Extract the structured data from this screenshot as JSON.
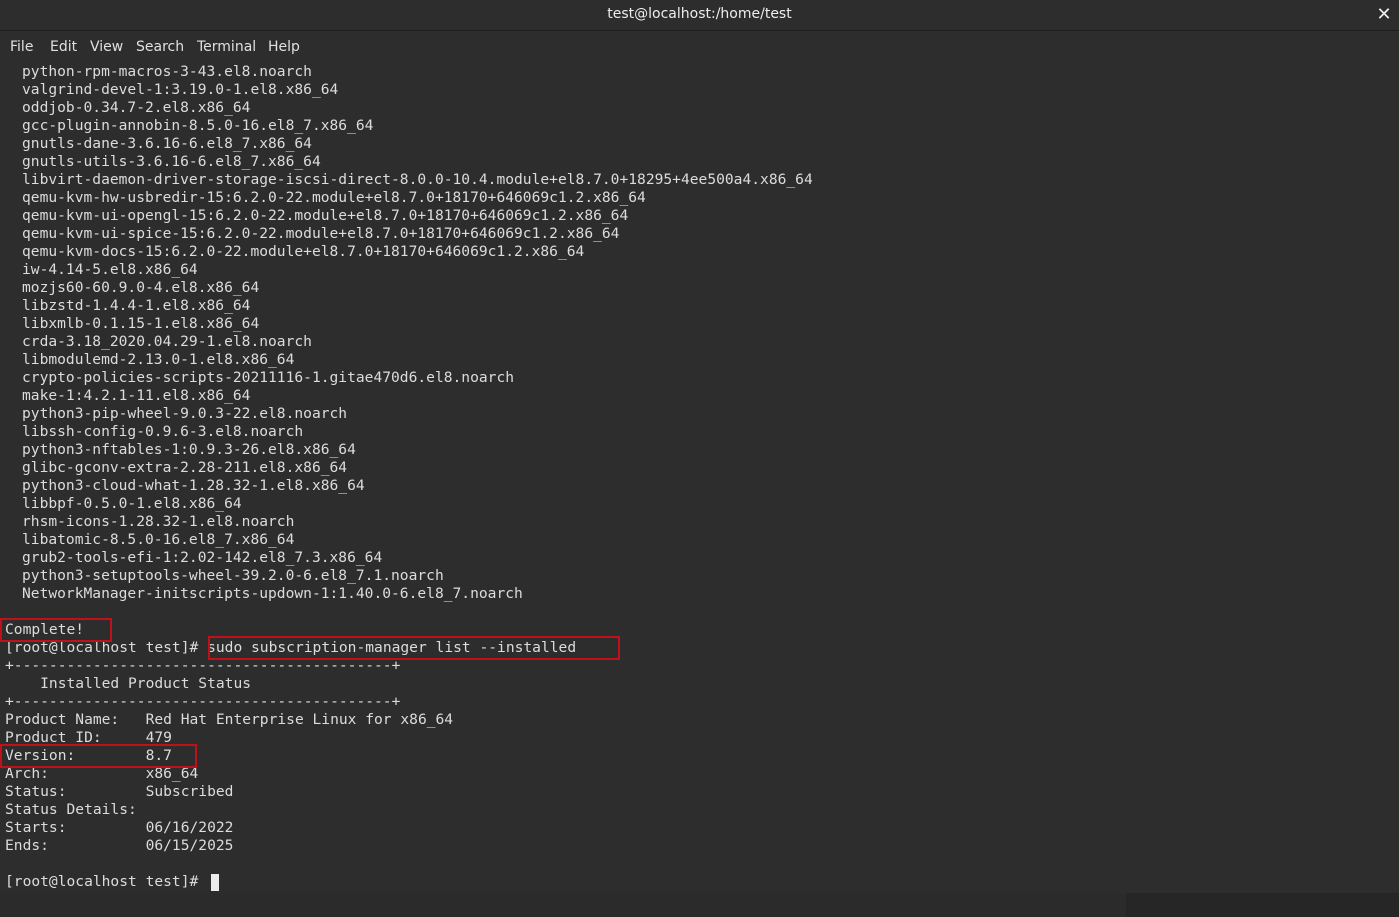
{
  "window": {
    "title": "test@localhost:/home/test",
    "close_glyph": "✕"
  },
  "menu": [
    "File",
    "Edit",
    "View",
    "Search",
    "Terminal",
    "Help"
  ],
  "terminal": {
    "packages": [
      "python-rpm-macros-3-43.el8.noarch",
      "valgrind-devel-1:3.19.0-1.el8.x86_64",
      "oddjob-0.34.7-2.el8.x86_64",
      "gcc-plugin-annobin-8.5.0-16.el8_7.x86_64",
      "gnutls-dane-3.6.16-6.el8_7.x86_64",
      "gnutls-utils-3.6.16-6.el8_7.x86_64",
      "libvirt-daemon-driver-storage-iscsi-direct-8.0.0-10.4.module+el8.7.0+18295+4ee500a4.x86_64",
      "qemu-kvm-hw-usbredir-15:6.2.0-22.module+el8.7.0+18170+646069c1.2.x86_64",
      "qemu-kvm-ui-opengl-15:6.2.0-22.module+el8.7.0+18170+646069c1.2.x86_64",
      "qemu-kvm-ui-spice-15:6.2.0-22.module+el8.7.0+18170+646069c1.2.x86_64",
      "qemu-kvm-docs-15:6.2.0-22.module+el8.7.0+18170+646069c1.2.x86_64",
      "iw-4.14-5.el8.x86_64",
      "mozjs60-60.9.0-4.el8.x86_64",
      "libzstd-1.4.4-1.el8.x86_64",
      "libxmlb-0.1.15-1.el8.x86_64",
      "crda-3.18_2020.04.29-1.el8.noarch",
      "libmodulemd-2.13.0-1.el8.x86_64",
      "crypto-policies-scripts-20211116-1.gitae470d6.el8.noarch",
      "make-1:4.2.1-11.el8.x86_64",
      "python3-pip-wheel-9.0.3-22.el8.noarch",
      "libssh-config-0.9.6-3.el8.noarch",
      "python3-nftables-1:0.9.3-26.el8.x86_64",
      "glibc-gconv-extra-2.28-211.el8.x86_64",
      "python3-cloud-what-1.28.32-1.el8.x86_64",
      "libbpf-0.5.0-1.el8.x86_64",
      "rhsm-icons-1.28.32-1.el8.noarch",
      "libatomic-8.5.0-16.el8_7.x86_64",
      "grub2-tools-efi-1:2.02-142.el8_7.3.x86_64",
      "python3-setuptools-wheel-39.2.0-6.el8_7.1.noarch",
      "NetworkManager-initscripts-updown-1:1.40.0-6.el8_7.noarch"
    ],
    "complete": "Complete!",
    "prompt": "[root@localhost test]# ",
    "command": "sudo subscription-manager list --installed",
    "divider": "+-------------------------------------------+",
    "status_header": "    Installed Product Status",
    "fields": [
      "Product Name:   Red Hat Enterprise Linux for x86_64",
      "Product ID:     479",
      "Version:        8.7",
      "Arch:           x86_64",
      "Status:         Subscribed",
      "Status Details:",
      "Starts:         06/16/2022",
      "Ends:           06/15/2025"
    ],
    "final_prompt": "[root@localhost test]# "
  },
  "colors": {
    "background": "#2d2d2d",
    "text": "#dcdcdc",
    "highlight_box": "#c0101a"
  }
}
